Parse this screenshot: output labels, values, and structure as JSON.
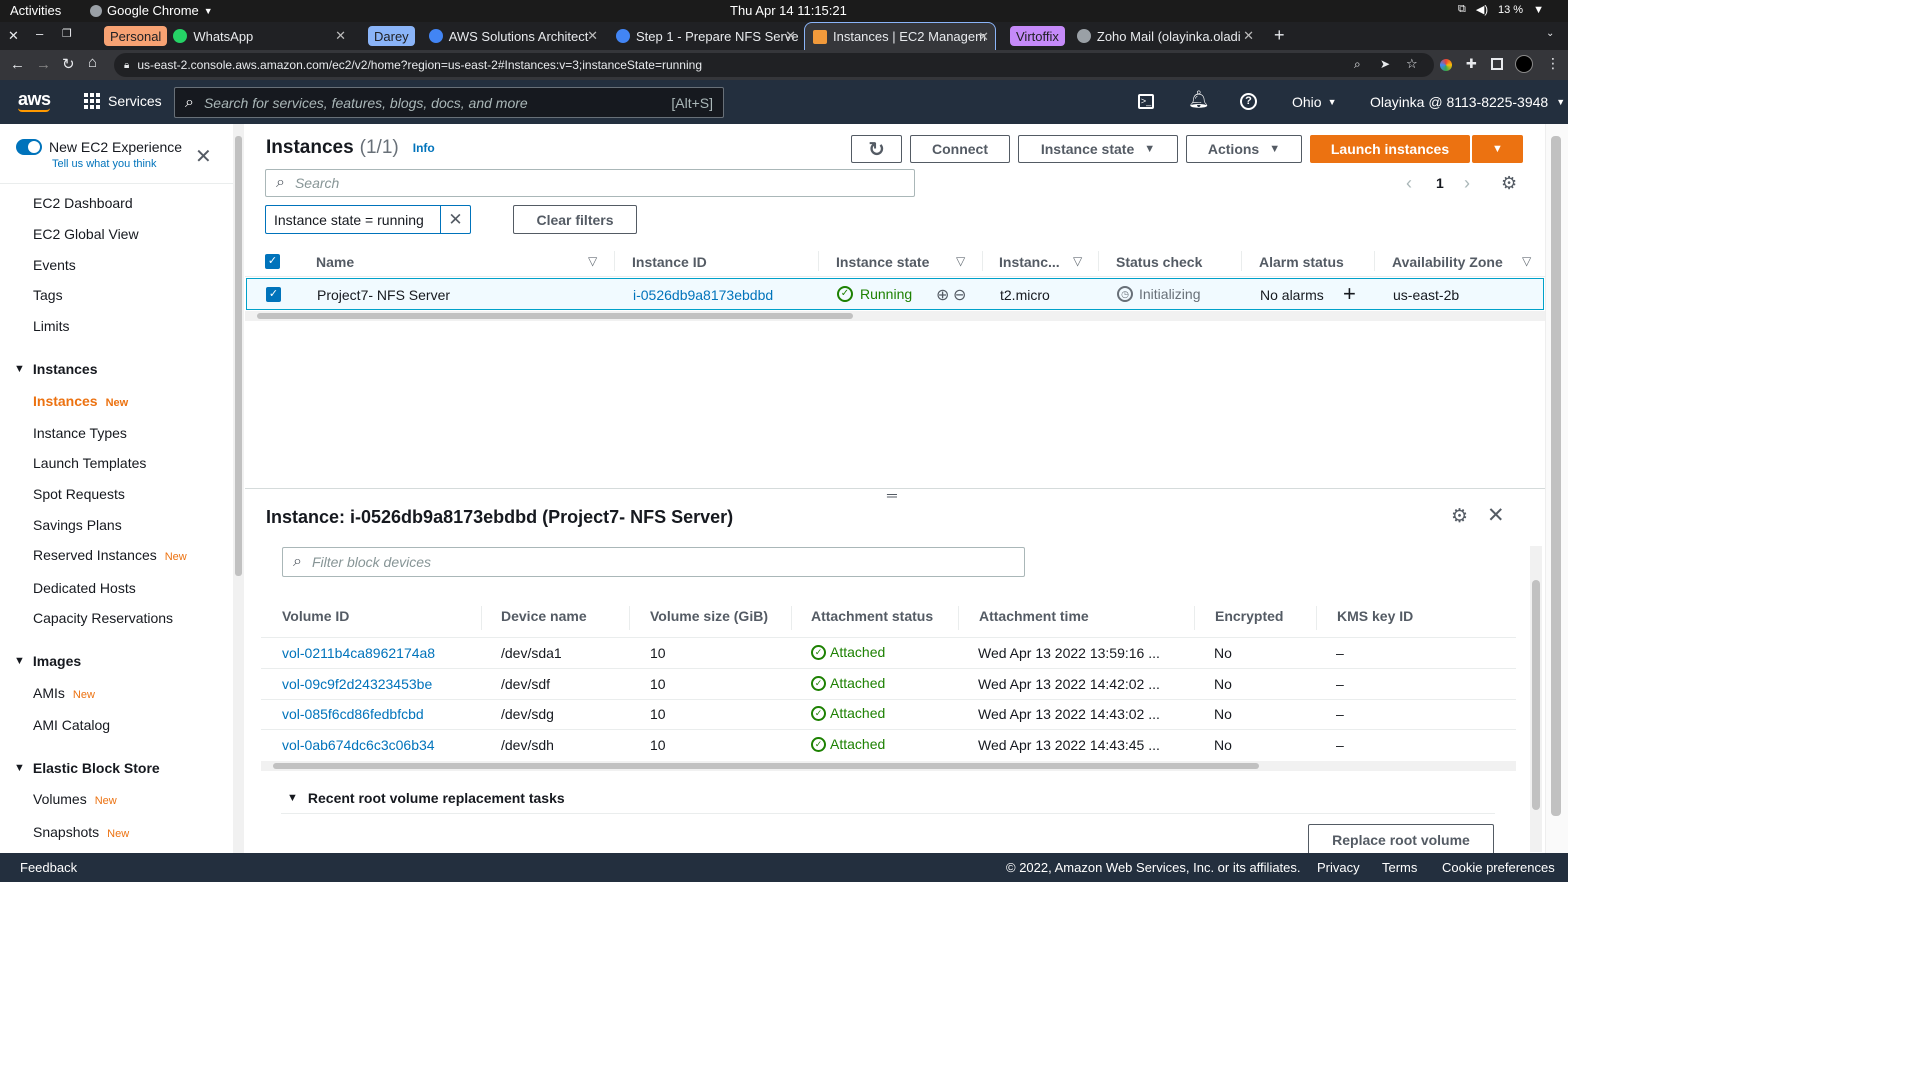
{
  "gnome": {
    "activities": "Activities",
    "app": "Google Chrome",
    "clock": "Thu Apr 14  11:15:21",
    "battery": "13 %"
  },
  "tabs": [
    {
      "group": "Personal",
      "title": "WhatsApp"
    },
    {
      "group": "Darey",
      "title": "AWS Solutions Architect"
    },
    {
      "title": "Step 1 - Prepare NFS Serve"
    },
    {
      "title": "Instances | EC2 Managem"
    },
    {
      "group": "Virtoffix",
      "title": "Zoho Mail (olayinka.oladi"
    }
  ],
  "url": "us-east-2.console.aws.amazon.com/ec2/v2/home?region=us-east-2#Instances:v=3;instanceState=running",
  "aws": {
    "logo": "aws",
    "services": "Services",
    "search_placeholder": "Search for services, features, blogs, docs, and more",
    "shortcut": "[Alt+S]",
    "region": "Ohio",
    "account": "Olayinka @ 8113-8225-3948"
  },
  "sidebar": {
    "toggle_title": "New EC2 Experience",
    "toggle_sub": "Tell us what you think",
    "items": [
      "EC2 Dashboard",
      "EC2 Global View",
      "Events",
      "Tags",
      "Limits"
    ],
    "sec_instances": "Instances",
    "instances_items": [
      "Instances",
      "Instance Types",
      "Launch Templates",
      "Spot Requests",
      "Savings Plans",
      "Reserved Instances",
      "Dedicated Hosts",
      "Capacity Reservations"
    ],
    "sec_images": "Images",
    "images_items": [
      "AMIs",
      "AMI Catalog"
    ],
    "sec_ebs": "Elastic Block Store",
    "ebs_items": [
      "Volumes",
      "Snapshots"
    ],
    "new_label": "New"
  },
  "main": {
    "title": "Instances",
    "count": "(1/1)",
    "info": "Info",
    "connect": "Connect",
    "instance_state": "Instance state",
    "actions": "Actions",
    "launch": "Launch instances",
    "search_placeholder": "Search",
    "page": "1",
    "filter_chip": "Instance state = running",
    "clear_filters": "Clear filters",
    "columns": [
      "Name",
      "Instance ID",
      "Instance state",
      "Instanc...",
      "Status check",
      "Alarm status",
      "Availability Zone"
    ],
    "row": {
      "name": "Project7- NFS Server",
      "id": "i-0526db9a8173ebdbd",
      "state": "Running",
      "type": "t2.micro",
      "status": "Initializing",
      "alarm": "No alarms",
      "az": "us-east-2b"
    }
  },
  "detail": {
    "title": "Instance: i-0526db9a8173ebdbd (Project7- NFS Server)",
    "filter_placeholder": "Filter block devices",
    "columns": [
      "Volume ID",
      "Device name",
      "Volume size (GiB)",
      "Attachment status",
      "Attachment time",
      "Encrypted",
      "KMS key ID"
    ],
    "rows": [
      {
        "vol": "vol-0211b4ca8962174a8",
        "dev": "/dev/sda1",
        "size": "10",
        "status": "Attached",
        "time": "Wed Apr 13 2022 13:59:16 ...",
        "enc": "No",
        "kms": "–"
      },
      {
        "vol": "vol-09c9f2d24323453be",
        "dev": "/dev/sdf",
        "size": "10",
        "status": "Attached",
        "time": "Wed Apr 13 2022 14:42:02 ...",
        "enc": "No",
        "kms": "–"
      },
      {
        "vol": "vol-085f6cd86fedbfcbd",
        "dev": "/dev/sdg",
        "size": "10",
        "status": "Attached",
        "time": "Wed Apr 13 2022 14:43:02 ...",
        "enc": "No",
        "kms": "–"
      },
      {
        "vol": "vol-0ab674dc6c3c06b34",
        "dev": "/dev/sdh",
        "size": "10",
        "status": "Attached",
        "time": "Wed Apr 13 2022 14:43:45 ...",
        "enc": "No",
        "kms": "–"
      }
    ],
    "recent": "Recent root volume replacement tasks",
    "replace": "Replace root volume"
  },
  "footer": {
    "feedback": "Feedback",
    "copyright": "© 2022, Amazon Web Services, Inc. or its affiliates.",
    "privacy": "Privacy",
    "terms": "Terms",
    "cookie": "Cookie preferences"
  },
  "colors": {
    "orange": "#ec7211",
    "link": "#0073bb",
    "success": "#1d8102",
    "header": "#232f3e"
  }
}
